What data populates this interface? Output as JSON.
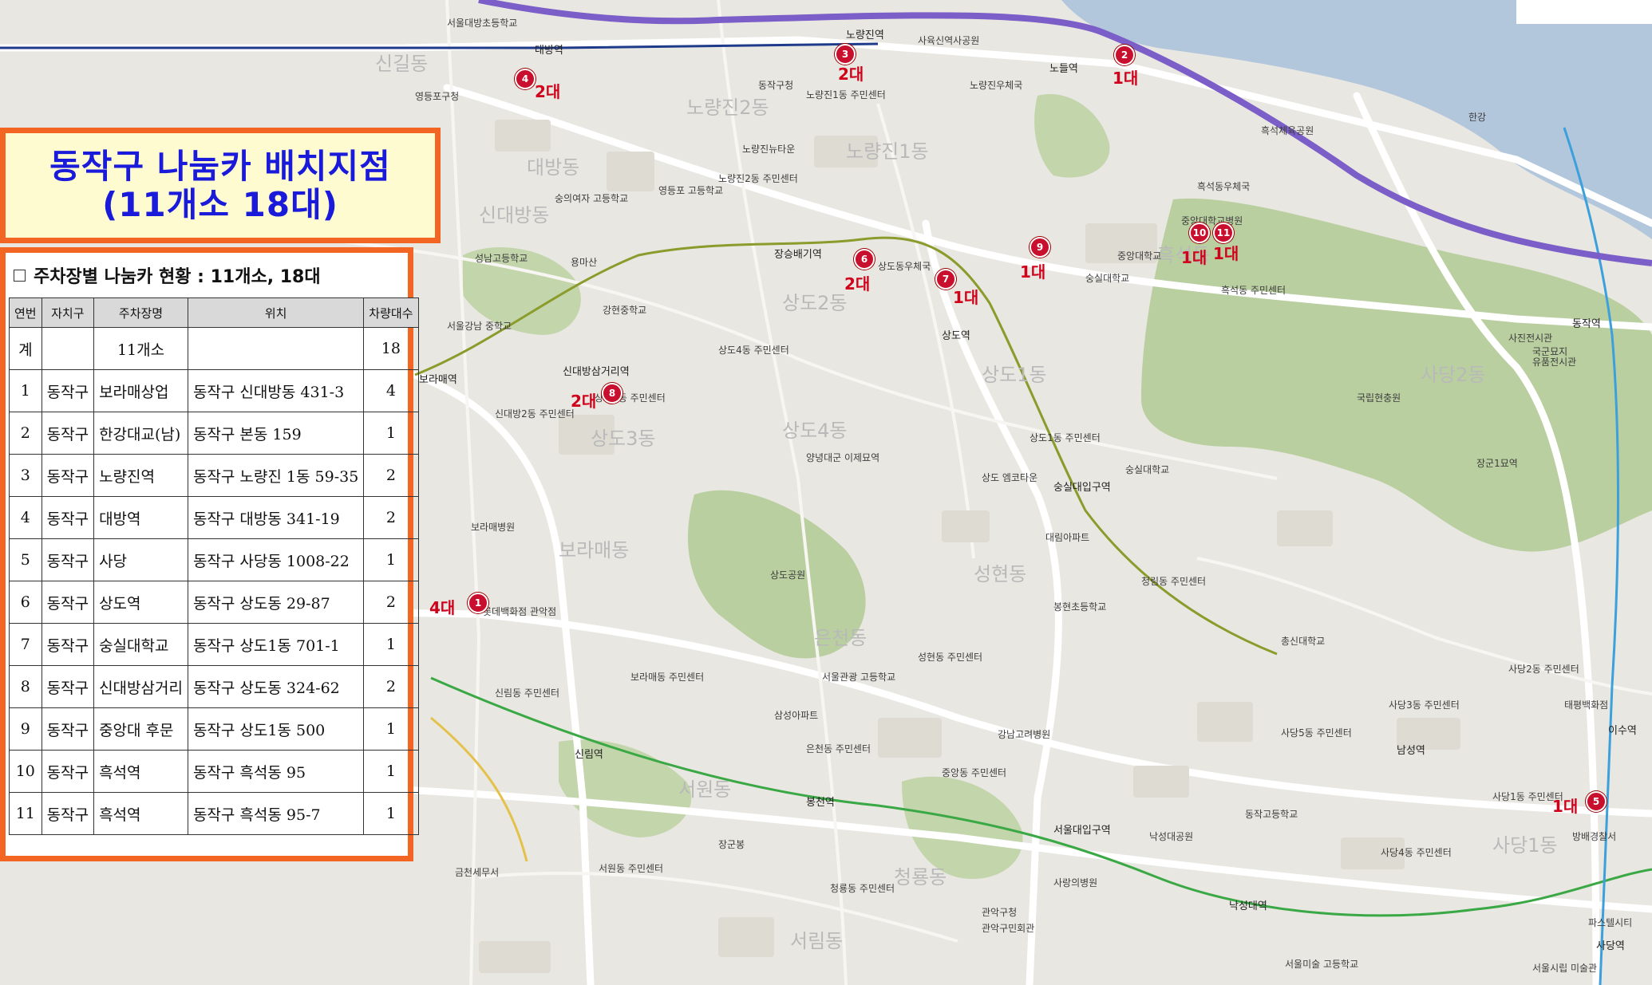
{
  "title": {
    "line1": "동작구 나눔카 배치지점",
    "line2": "(11개소 18대)"
  },
  "table": {
    "caption": "주차장별 나눔카 현황 : 11개소, 18대",
    "headers": [
      "연번",
      "자치구",
      "주차장명",
      "위치",
      "차량대수"
    ],
    "total": {
      "label": "계",
      "name": "11개소",
      "count": "18"
    },
    "rows": [
      {
        "no": "1",
        "district": "동작구",
        "name": "보라매상업",
        "location": "동작구 신대방동 431-3",
        "count": "4"
      },
      {
        "no": "2",
        "district": "동작구",
        "name": "한강대교(남)",
        "location": "동작구 본동 159",
        "count": "1"
      },
      {
        "no": "3",
        "district": "동작구",
        "name": "노량진역",
        "location": "동작구 노량진 1동 59-35",
        "count": "2"
      },
      {
        "no": "4",
        "district": "동작구",
        "name": "대방역",
        "location": "동작구 대방동 341-19",
        "count": "2"
      },
      {
        "no": "5",
        "district": "동작구",
        "name": "사당",
        "location": "동작구 사당동 1008-22",
        "count": "1"
      },
      {
        "no": "6",
        "district": "동작구",
        "name": "상도역",
        "location": "동작구 상도동 29-87",
        "count": "2"
      },
      {
        "no": "7",
        "district": "동작구",
        "name": "숭실대학교",
        "location": "동작구 상도1동 701-1",
        "count": "1"
      },
      {
        "no": "8",
        "district": "동작구",
        "name": "신대방삼거리",
        "location": "동작구 상도동 324-62",
        "count": "2"
      },
      {
        "no": "9",
        "district": "동작구",
        "name": "중앙대 후문",
        "location": "동작구 상도1동 500",
        "count": "1"
      },
      {
        "no": "10",
        "district": "동작구",
        "name": "흑석역",
        "location": "동작구 흑석동 95",
        "count": "1"
      },
      {
        "no": "11",
        "district": "동작구",
        "name": "흑석역",
        "location": "동작구 흑석동 95-7",
        "count": "1"
      }
    ]
  },
  "markers": [
    {
      "num": "1",
      "count": "4대"
    },
    {
      "num": "2",
      "count": "1대"
    },
    {
      "num": "3",
      "count": "2대"
    },
    {
      "num": "4",
      "count": "2대"
    },
    {
      "num": "5",
      "count": "1대"
    },
    {
      "num": "6",
      "count": "2대"
    },
    {
      "num": "7",
      "count": "1대"
    },
    {
      "num": "8",
      "count": "2대"
    },
    {
      "num": "9",
      "count": "1대"
    },
    {
      "num": "10",
      "count": "1대"
    },
    {
      "num": "11",
      "count": "1대"
    }
  ],
  "map_labels": {
    "big": [
      "노량진2동",
      "노량진1동",
      "흑석동",
      "상도2동",
      "상도3동",
      "상도4동",
      "상도1동",
      "사당2동",
      "신대방동",
      "대방동",
      "보라매동",
      "은천동",
      "성현동",
      "서원동",
      "사당1동",
      "서림동",
      "청룡동",
      "신길동"
    ],
    "stations": [
      "대방역",
      "노량진역",
      "노들역",
      "장승배기역",
      "상도역",
      "숭실대입구역",
      "신대방삼거리역",
      "보라매역",
      "신림역",
      "봉천역",
      "서울대입구역",
      "낙성대역",
      "사당역",
      "동작역",
      "이수역",
      "남성역"
    ],
    "places": [
      "영등포구청",
      "서울대방초등학교",
      "동작구청",
      "노량진1동 주민센터",
      "노량진2동 주민센터",
      "노량진뉴타운",
      "사육신역사공원",
      "노량진우체국",
      "한강",
      "흑석체육공원",
      "흑석동우체국",
      "중앙대학교병원",
      "중앙대학교",
      "흑석동 주민센터",
      "국립현충원",
      "국군묘지",
      "장군1묘역",
      "상도동우체국",
      "상도4동 주민센터",
      "상도3동 주민센터",
      "양녕대군 이제묘역",
      "상도공원",
      "숭실대학교",
      "상도1동 주민센터",
      "성현동 주민센터",
      "청림동 주민센터",
      "보라매병원",
      "롯데백화점 관악점",
      "보라매동 주민센터",
      "서울관광 고등학교",
      "강남고려병원",
      "중앙동 주민센터",
      "은천동 주민센터",
      "총신대학교",
      "사당5동 주민센터",
      "사당3동 주민센터",
      "사당1동 주민센터",
      "관악구청",
      "관악구민회관",
      "서원동 주민센터",
      "신림동 주민센터",
      "금천세무서",
      "청룡동 주민센터",
      "사랑의병원",
      "태평백화점",
      "방배경찰서",
      "파스텔시티",
      "서울시립 미술관",
      "숭실대학교",
      "강현중학교",
      "영등포 고등학교",
      "용마산",
      "서울강남 중학교",
      "신대방2동 주민센터",
      "동작고등학교",
      "서울미술 고등학교",
      "사당4동 주민센터",
      "사당2동 주민센터",
      "유품전시관",
      "사진전시관",
      "삼성아파트",
      "상도 엠코타운",
      "숭의여자 고등학교",
      "성남고등학교",
      "장군봉",
      "낙성대공원",
      "봉현초등학교",
      "대림아파트"
    ]
  }
}
